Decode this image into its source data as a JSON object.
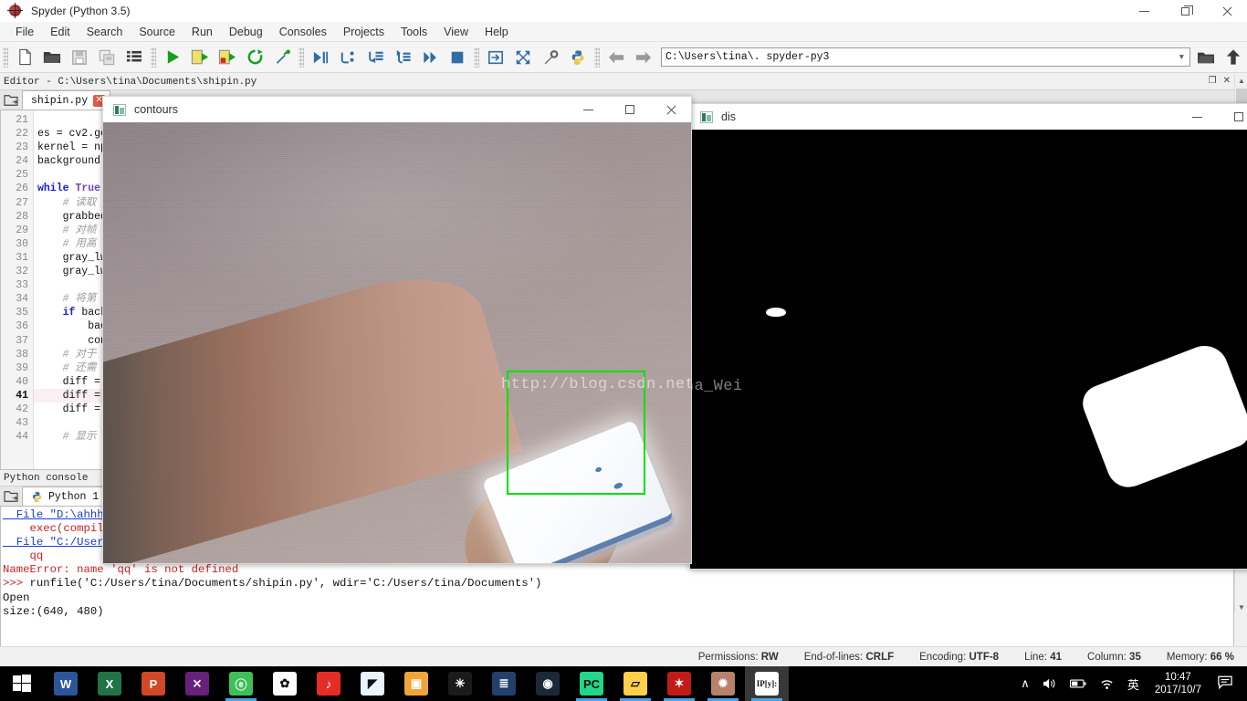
{
  "window": {
    "title": "Spyder (Python 3.5)",
    "app_icon": "spyder-logo-icon",
    "minimize": "minimize-icon",
    "restore": "restore-icon",
    "close": "close-icon"
  },
  "menubar": {
    "items": [
      {
        "label": "File"
      },
      {
        "label": "Edit"
      },
      {
        "label": "Search"
      },
      {
        "label": "Source"
      },
      {
        "label": "Run"
      },
      {
        "label": "Debug"
      },
      {
        "label": "Consoles"
      },
      {
        "label": "Projects"
      },
      {
        "label": "Tools"
      },
      {
        "label": "View"
      },
      {
        "label": "Help"
      }
    ]
  },
  "toolbar": {
    "buttons": [
      {
        "name": "new-file-icon",
        "tip": "New file"
      },
      {
        "name": "open-file-icon",
        "tip": "Open file"
      },
      {
        "name": "save-file-icon",
        "tip": "Save file"
      },
      {
        "name": "save-all-icon",
        "tip": "Save all"
      },
      {
        "name": "file-switcher-icon",
        "tip": "File switcher"
      },
      {
        "name": "run-file-icon",
        "tip": "Run file"
      },
      {
        "name": "run-cell-icon",
        "tip": "Run current cell"
      },
      {
        "name": "run-cell-advance-icon",
        "tip": "Run cell and advance"
      },
      {
        "name": "rerun-icon",
        "tip": "Re-run last script"
      },
      {
        "name": "configure-run-icon",
        "tip": "Configuration per file"
      },
      {
        "name": "debug-file-icon",
        "tip": "Debug file"
      },
      {
        "name": "step-over-icon",
        "tip": "Run current line"
      },
      {
        "name": "step-into-icon",
        "tip": "Step into function"
      },
      {
        "name": "step-return-icon",
        "tip": "Run until function returns"
      },
      {
        "name": "continue-icon",
        "tip": "Continue execution"
      },
      {
        "name": "stop-debug-icon",
        "tip": "Stop debugging"
      },
      {
        "name": "maximize-pane-icon",
        "tip": "Maximize current pane"
      },
      {
        "name": "fullscreen-icon",
        "tip": "Fullscreen mode"
      },
      {
        "name": "preferences-icon",
        "tip": "Preferences"
      },
      {
        "name": "pythonpath-icon",
        "tip": "PYTHONPATH manager"
      },
      {
        "name": "back-icon",
        "tip": "Back"
      },
      {
        "name": "forward-icon",
        "tip": "Forward"
      }
    ],
    "path_value": "C:\\Users\\tina\\. spyder-py3",
    "path_dropdown_icon": "chevron-down-icon",
    "browse_folder_icon": "open-folder-icon",
    "parent_dir_icon": "arrow-up-icon"
  },
  "editor": {
    "pane_title": "Editor - C:\\Users\\tina\\Documents\\shipin.py",
    "browse_tabs_icon": "browse-tabs-icon",
    "tab": {
      "label": "shipin.py",
      "close_icon": "tab-close-icon"
    },
    "current_line": 41,
    "lines": [
      {
        "n": 21,
        "text": ""
      },
      {
        "n": 22,
        "text": "es = cv2.ge"
      },
      {
        "n": 23,
        "text": "kernel = np"
      },
      {
        "n": 24,
        "text": "background"
      },
      {
        "n": 25,
        "text": ""
      },
      {
        "n": 26,
        "text": "while True:"
      },
      {
        "n": 27,
        "text": "    # 读取"
      },
      {
        "n": 28,
        "text": "    grabbed"
      },
      {
        "n": 29,
        "text": "    # 对帧"
      },
      {
        "n": 30,
        "text": "    # 用高"
      },
      {
        "n": 31,
        "text": "    gray_lw"
      },
      {
        "n": 32,
        "text": "    gray_lw"
      },
      {
        "n": 33,
        "text": ""
      },
      {
        "n": 34,
        "text": "    # 将第"
      },
      {
        "n": 35,
        "text": "    if back"
      },
      {
        "n": 36,
        "text": "        bac"
      },
      {
        "n": 37,
        "text": "        con"
      },
      {
        "n": 38,
        "text": "    # 对于"
      },
      {
        "n": 39,
        "text": "    # 还需"
      },
      {
        "n": 40,
        "text": "    diff = "
      },
      {
        "n": 41,
        "text": "    diff = "
      },
      {
        "n": 42,
        "text": "    diff = "
      },
      {
        "n": 43,
        "text": ""
      },
      {
        "n": 44,
        "text": "    # 显示"
      }
    ]
  },
  "console": {
    "pane_title": "Python console",
    "browse_tabs_icon": "browse-tabs-icon",
    "tab": {
      "label": "Python 1",
      "icon": "python-icon",
      "close_icon": "tab-close-icon"
    },
    "lines": [
      {
        "text": "  File \"D:\\ahhhl",
        "style": "file"
      },
      {
        "text": "    exec(compil",
        "style": "err"
      },
      {
        "text": "  File \"C:/User",
        "style": "file"
      },
      {
        "text": "    qq",
        "style": "err"
      },
      {
        "text": "NameError: name 'qq' is not defined",
        "style": "err"
      },
      {
        "text": ">>> runfile('C:/Users/tina/Documents/shipin.py', wdir='C:/Users/tina/Documents')",
        "style": "prompt"
      },
      {
        "text": "Open",
        "style": "plain"
      },
      {
        "text": "size:(640, 480)",
        "style": "plain"
      }
    ]
  },
  "statusbar": {
    "items": [
      {
        "label": "Permissions:",
        "value": "RW"
      },
      {
        "label": "End-of-lines:",
        "value": "CRLF"
      },
      {
        "label": "Encoding:",
        "value": "UTF-8"
      },
      {
        "label": "Line:",
        "value": "41"
      },
      {
        "label": "Column:",
        "value": "35"
      },
      {
        "label": "Memory:",
        "value": "66 %"
      }
    ]
  },
  "cv_windows": [
    {
      "title": "contours",
      "app_icon": "opencv-window-icon",
      "minimize": "minimize-icon",
      "maximize": "maximize-icon",
      "close": "close-icon",
      "watermark": "http://blog.csdn.net/Tina_Wei",
      "overlay": "green-bounding-box"
    },
    {
      "title": "dis",
      "app_icon": "opencv-window-icon",
      "minimize": "minimize-icon",
      "maximize": "maximize-icon",
      "watermark": "Tina_Wei"
    }
  ],
  "taskbar": {
    "start_icon": "windows-start-icon",
    "apps": [
      {
        "name": "word-icon",
        "label": "W",
        "color": "#2b579a",
        "running": false
      },
      {
        "name": "excel-icon",
        "label": "X",
        "color": "#217346",
        "running": false
      },
      {
        "name": "powerpoint-icon",
        "label": "P",
        "color": "#d24726",
        "running": false
      },
      {
        "name": "visual-studio-icon",
        "label": "⨯",
        "color": "#68217a",
        "running": false
      },
      {
        "name": "360-browser-icon",
        "label": "ⓔ",
        "color": "#3fbf5a",
        "running": true
      },
      {
        "name": "qq-icon",
        "label": "✿",
        "color": "#ffffff",
        "running": false
      },
      {
        "name": "netease-music-icon",
        "label": "♪",
        "color": "#e52d27",
        "running": false
      },
      {
        "name": "foxmail-icon",
        "label": "◤",
        "color": "#e9f4ff",
        "running": false
      },
      {
        "name": "evernote-icon",
        "label": "▣",
        "color": "#f2a43a",
        "running": false
      },
      {
        "name": "atom-icon",
        "label": "✳",
        "color": "#1b1b1b",
        "running": false
      },
      {
        "name": "sublime-text-icon",
        "label": "≣",
        "color": "#23406b",
        "running": false
      },
      {
        "name": "steam-icon",
        "label": "◉",
        "color": "#1b2838",
        "running": false
      },
      {
        "name": "pycharm-icon",
        "label": "PC",
        "color": "#21d789",
        "running": true
      },
      {
        "name": "file-explorer-icon",
        "label": "▱",
        "color": "#ffd04b",
        "running": true
      },
      {
        "name": "mathematica-icon",
        "label": "✶",
        "color": "#c21b17",
        "running": true
      },
      {
        "name": "spyder-app-icon",
        "label": "✹",
        "color": "#b8826a",
        "running": true
      },
      {
        "name": "ipython-qtconsole-icon",
        "label": "IP[y]:",
        "color": "#ffffff",
        "running": true,
        "active": true
      }
    ],
    "tray": [
      {
        "name": "show-hidden-icons-icon",
        "glyph": "∧"
      },
      {
        "name": "volume-icon",
        "glyph": "🔊"
      },
      {
        "name": "battery-icon",
        "glyph": "▤"
      },
      {
        "name": "wifi-icon",
        "glyph": "📶"
      },
      {
        "name": "ime-language-icon",
        "glyph": "英"
      }
    ],
    "clock": {
      "time": "10:47",
      "date": "2017/10/7"
    },
    "notification_icon": "action-center-icon"
  },
  "colors": {
    "accent_blue": "#2f6ea5",
    "run_green": "#14a01e",
    "bbox_green": "#00e000",
    "error_red": "#cc2222",
    "link_blue": "#1a3fd0"
  }
}
